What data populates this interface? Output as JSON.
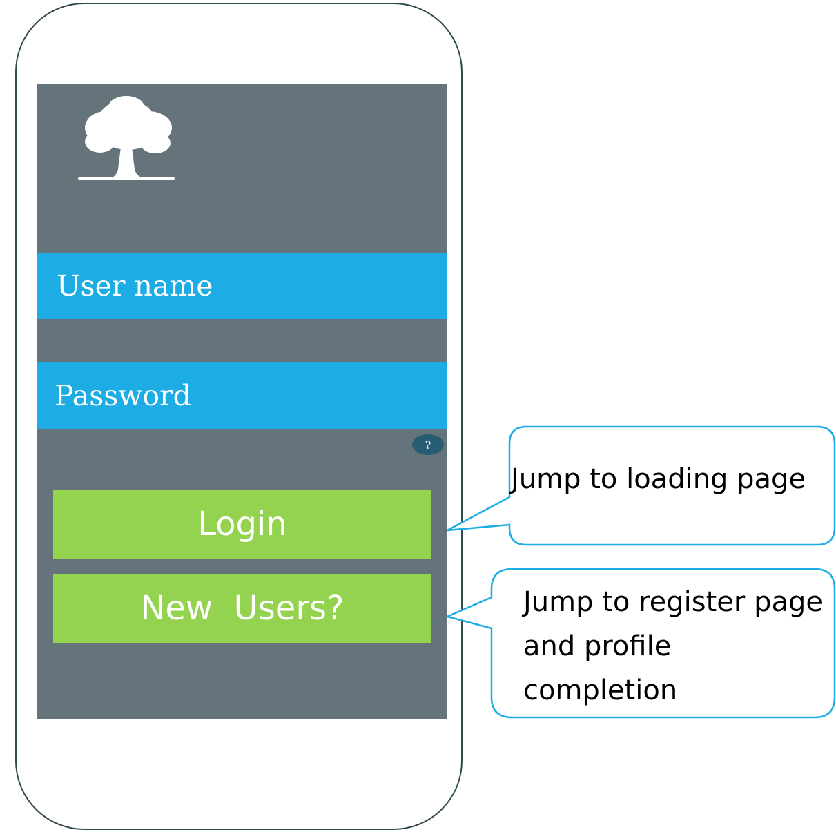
{
  "login_form": {
    "username_placeholder": "User name",
    "password_placeholder": "Password",
    "help_icon_text": "?",
    "login_label": "Login",
    "new_users_label": "New  Users?"
  },
  "callouts": {
    "login": "Jump to loading page",
    "register": "Jump to register page and profile completion"
  },
  "icons": {
    "logo": "tree-icon",
    "help": "help-icon"
  },
  "colors": {
    "screen_bg": "#65737b",
    "field_bg": "#1dace3",
    "button_bg": "#94d34f",
    "callout_border": "#1dace3",
    "phone_border": "#2f4a4e"
  }
}
